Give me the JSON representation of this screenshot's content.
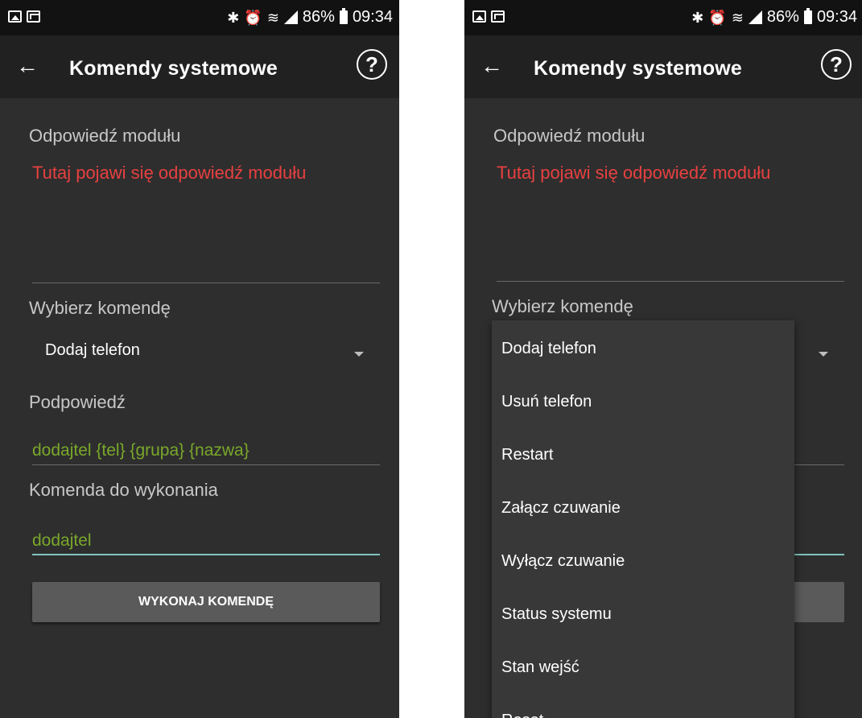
{
  "status_bar": {
    "bluetooth_icon": "bluetooth-icon",
    "alarm_icon": "alarm-icon",
    "wifi_icon": "wifi-icon",
    "battery_percent": "86%",
    "time": "09:34"
  },
  "toolbar": {
    "title": "Komendy systemowe",
    "back_icon": "arrow-left-icon",
    "help_label": "?"
  },
  "module_response": {
    "label": "Odpowiedź modułu",
    "text": "Tutaj pojawi się odpowiedź modułu"
  },
  "command_select": {
    "label": "Wybierz komendę",
    "selected": "Dodaj telefon",
    "options": [
      "Dodaj telefon",
      "Usuń telefon",
      "Restart",
      "Załącz czuwanie",
      "Wyłącz czuwanie",
      "Status systemu",
      "Stan wejść",
      "Reset"
    ]
  },
  "hint": {
    "label": "Podpowiedź",
    "text": "dodajtel {tel} {grupa} {nazwa}"
  },
  "command_input": {
    "label": "Komenda do wykonania",
    "value": "dodajtel"
  },
  "execute_button": {
    "label": "WYKONAJ KOMENDĘ"
  },
  "colors": {
    "background": "#2e2e2e",
    "toolbar": "#212121",
    "response_text": "#e84040",
    "hint_text": "#7aa82a",
    "input_underline": "#7fc4bc",
    "button": "#5a5a5a"
  }
}
